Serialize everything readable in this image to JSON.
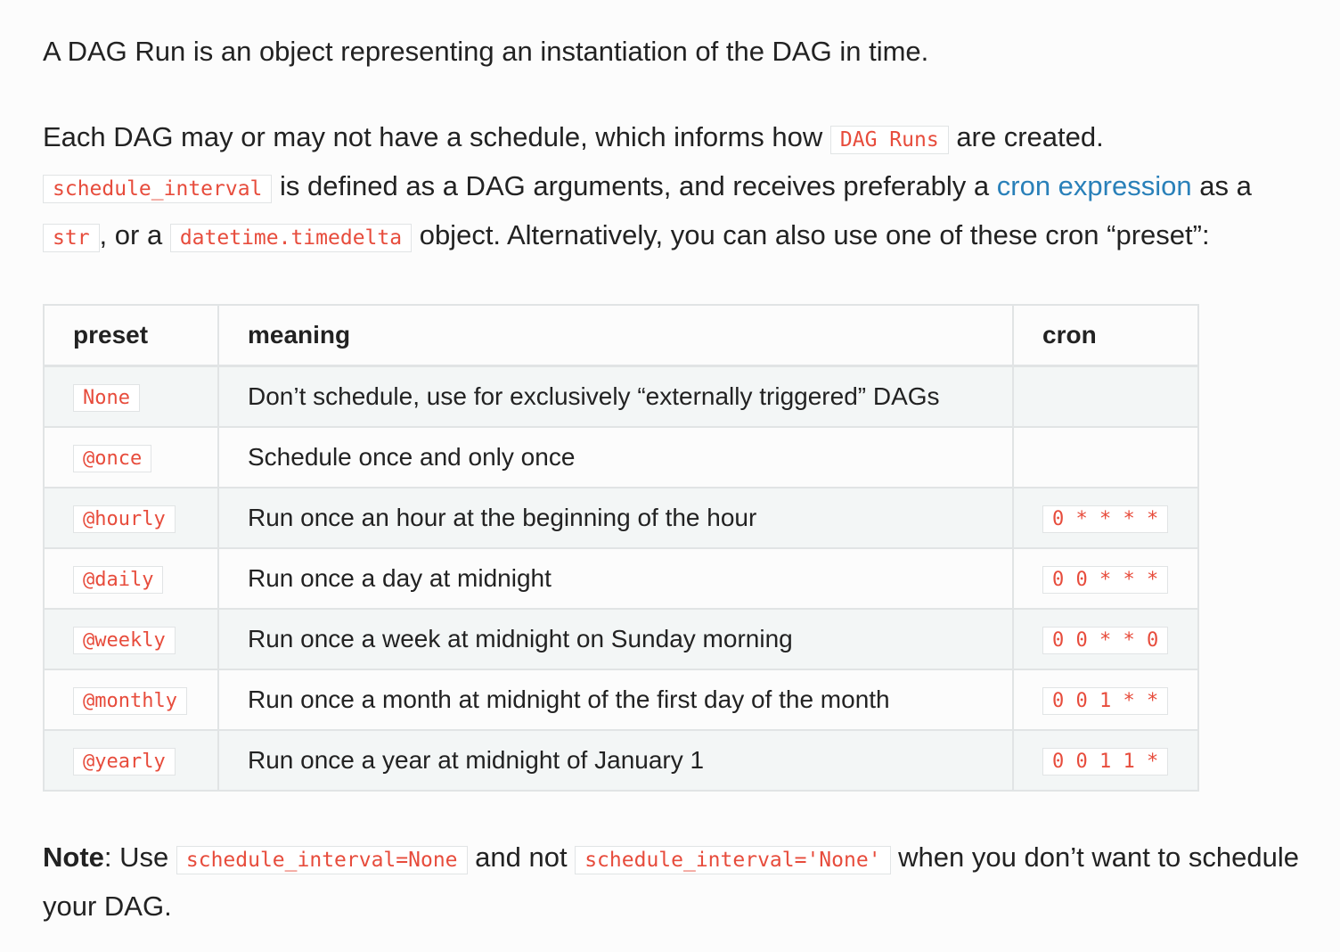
{
  "intro": "A DAG Run is an object representing an instantiation of the DAG in time.",
  "para2": {
    "t1": "Each DAG may or may not have a schedule, which informs how",
    "c1": "DAG Runs",
    "t2": "are created.",
    "c2": "schedule_interval",
    "t3": "is defined as a DAG arguments, and receives preferably a",
    "link": "cron expression",
    "t4": "as a",
    "c3": "str",
    "t5": ", or a",
    "c4": "datetime.timedelta",
    "t6": "object. Alternatively, you can also use one of these cron “preset”:"
  },
  "table": {
    "headers": [
      "preset",
      "meaning",
      "cron"
    ],
    "rows": [
      {
        "preset": "None",
        "meaning": "Don’t schedule, use for exclusively “externally triggered” DAGs",
        "cron": ""
      },
      {
        "preset": "@once",
        "meaning": "Schedule once and only once",
        "cron": ""
      },
      {
        "preset": "@hourly",
        "meaning": "Run once an hour at the beginning of the hour",
        "cron": "0 * * * *"
      },
      {
        "preset": "@daily",
        "meaning": "Run once a day at midnight",
        "cron": "0 0 * * *"
      },
      {
        "preset": "@weekly",
        "meaning": "Run once a week at midnight on Sunday morning",
        "cron": "0 0 * * 0"
      },
      {
        "preset": "@monthly",
        "meaning": "Run once a month at midnight of the first day of the month",
        "cron": "0 0 1 * *"
      },
      {
        "preset": "@yearly",
        "meaning": "Run once a year at midnight of January 1",
        "cron": "0 0 1 1 *"
      }
    ]
  },
  "note": {
    "label": "Note",
    "t1": ": Use",
    "c1": "schedule_interval=None",
    "t2": "and not",
    "c2": "schedule_interval='None'",
    "t3": "when you don’t want to schedule your DAG."
  }
}
